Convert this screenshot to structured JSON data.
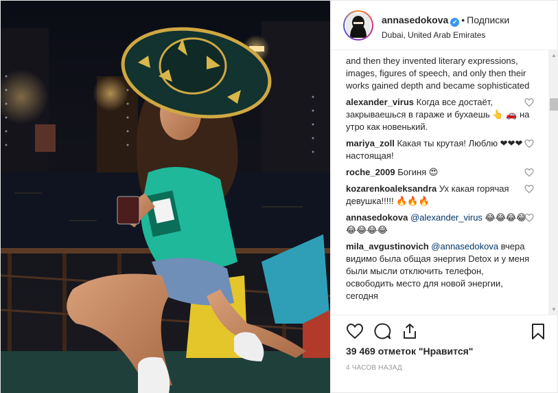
{
  "header": {
    "username": "annasedokova",
    "verified_mark": "✔",
    "separator": "•",
    "follow_label": "Подписки",
    "location": "Dubai, United Arab Emirates"
  },
  "comments": [
    {
      "user": "",
      "text": "and then they invented literary expressions, images, figures of speech, and only then their works gained depth and became sophisticated",
      "has_heart": false
    },
    {
      "user": "alexander_virus",
      "text": "Когда все достаёт, закрываешься в гараже и бухаешь 👆 🚗 на утро как новенький.",
      "has_heart": true
    },
    {
      "user": "mariya_zoll",
      "text": "Какая ты крутая! Люблю ❤❤❤ настоящая!",
      "has_heart": true
    },
    {
      "user": "roche_2009",
      "text": "Богиня 😍",
      "has_heart": true
    },
    {
      "user": "kozarenkoaleksandra",
      "text": "Ух какая горячая девушка!!!!! 🔥🔥🔥",
      "has_heart": true
    },
    {
      "user": "annasedokova",
      "mention": "@alexander_virus",
      "text": " 😂😂😂😂😂😂😂😂",
      "has_heart": true
    },
    {
      "user": "mila_avgustinovich",
      "mention": "@annasedokova",
      "text": " вчера видимо была общая энергия Detox и у меня были мысли отключить телефон, освободить место для новой энергии, сегодня",
      "has_heart": false
    }
  ],
  "scrollbar": {
    "up": "▲",
    "down": "▼"
  },
  "actions": {
    "like_icon": "heart-icon",
    "comment_icon": "comment-icon",
    "share_icon": "share-icon",
    "save_icon": "bookmark-icon"
  },
  "likes_text": "39 469 отметок \"Нравится\"",
  "timestamp": "4 ЧАСОВ НАЗАД",
  "colors": {
    "accent": "#3897f0",
    "mention": "#003569",
    "muted": "#999999"
  }
}
